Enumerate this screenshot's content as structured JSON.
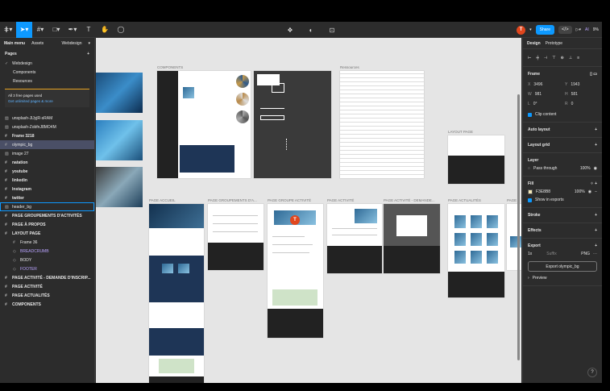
{
  "toolbar": {
    "menu_icon": "figma-menu-icon",
    "tools": [
      "move-tool",
      "frame-tool",
      "shape-tool",
      "pen-tool",
      "text-tool",
      "hand-tool",
      "comment-tool"
    ],
    "avatar_letter": "T",
    "share_label": "Share",
    "ai_label": "AI",
    "zoom": "9%"
  },
  "left_panel": {
    "tab_main": "Main menu",
    "tab_assets": "Assets",
    "file_name": "Webdesign",
    "pages_header": "Pages",
    "pages": [
      {
        "label": "Webdesign",
        "selected": true
      },
      {
        "label": "Components",
        "selected": false
      },
      {
        "label": "Resources",
        "selected": false
      }
    ],
    "notice_text": "All 3 free pages used",
    "notice_link": "Get unlimited pages & more",
    "layers": [
      {
        "icon": "image",
        "label": "unsplash-JlJyjR-sRAM",
        "style": ""
      },
      {
        "icon": "image",
        "label": "unsplash-ZobfnJ8MO4M",
        "style": ""
      },
      {
        "icon": "frame",
        "label": "Frame 3218",
        "style": "bold"
      },
      {
        "icon": "frame",
        "label": "olympic_bg",
        "style": "sel"
      },
      {
        "icon": "image",
        "label": "image 27",
        "style": ""
      },
      {
        "icon": "frame",
        "label": "natation",
        "style": "bold"
      },
      {
        "icon": "frame",
        "label": "youtube",
        "style": "bold"
      },
      {
        "icon": "frame",
        "label": "linkedin",
        "style": "bold"
      },
      {
        "icon": "frame",
        "label": "Instagram",
        "style": "bold"
      },
      {
        "icon": "frame",
        "label": "twitter",
        "style": "bold"
      },
      {
        "icon": "image",
        "label": "header_bg",
        "style": "outline"
      },
      {
        "icon": "frame",
        "label": "PAGE GROUPEMENTS D'ACTIVITÉS",
        "style": "bold"
      },
      {
        "icon": "frame",
        "label": "PAGE À PROPOS",
        "style": "bold"
      },
      {
        "icon": "frame",
        "label": "LAYOUT PAGE",
        "style": "bold"
      },
      {
        "icon": "frame",
        "label": "Frame 36",
        "style": "indent"
      },
      {
        "icon": "component",
        "label": "BREADCRUMB",
        "style": "purple"
      },
      {
        "icon": "component",
        "label": "BODY",
        "style": "indent"
      },
      {
        "icon": "component",
        "label": "FOOTER",
        "style": "purple"
      },
      {
        "icon": "frame",
        "label": "PAGE ACTIVITÉ - DEMANDE D'INSCRIP...",
        "style": "bold"
      },
      {
        "icon": "frame",
        "label": "PAGE ACTIVITÉ",
        "style": "bold"
      },
      {
        "icon": "frame",
        "label": "PAGE ACTUALITÉS",
        "style": "bold"
      },
      {
        "icon": "frame",
        "label": "COMPONENTS",
        "style": "bold"
      }
    ]
  },
  "canvas": {
    "labels": {
      "components": "COMPONENTS",
      "resources": "Ressources",
      "layout": "LAYOUT PAGE",
      "accueil": "PAGE ACCUEIL",
      "groupements": "PAGE GROUPEMENTS D'A...",
      "groupe": "PAGE GROUPE ACTIVITÉ",
      "activite": "PAGE ACTIVITÉ",
      "demande": "PAGE ACTIVITÉ - DEMANDE...",
      "actualites": "PAGE ACTUALITÉS",
      "extra": "PAGE"
    },
    "pin_letter": "T"
  },
  "right_panel": {
    "tab_design": "Design",
    "tab_prototype": "Prototype",
    "frame_label": "Frame",
    "fields": [
      {
        "k": "X",
        "v": "3496"
      },
      {
        "k": "Y",
        "v": "1943"
      },
      {
        "k": "W",
        "v": "981"
      },
      {
        "k": "H",
        "v": "581"
      },
      {
        "k": "L",
        "v": "0°"
      },
      {
        "k": "R",
        "v": "0"
      }
    ],
    "clip_content": "Clip content",
    "auto_layout": "Auto layout",
    "layout_grid": "Layout grid",
    "layer_title": "Layer",
    "blend_mode": "Pass through",
    "layer_opacity": "100%",
    "fill_title": "Fill",
    "fill_hex": "F3E8B8",
    "fill_opacity": "100%",
    "show_in_exports": "Show in exports",
    "stroke_title": "Stroke",
    "effects_title": "Effects",
    "export_title": "Export",
    "export_scale": "1x",
    "export_suffix": "Suffix",
    "export_format": "PNG",
    "export_button": "Export olympic_bg",
    "preview": "Preview",
    "help": "?"
  }
}
